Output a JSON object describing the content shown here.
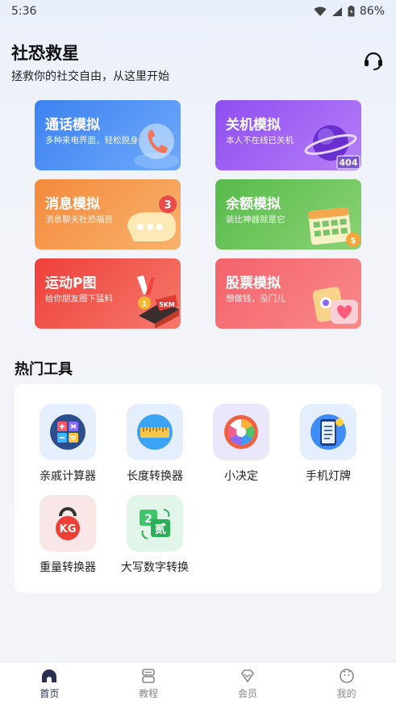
{
  "status_bar": {
    "time": "5:36",
    "battery": "86%"
  },
  "header": {
    "title": "社恐救星",
    "subtitle": "拯救你的社交自由，从这里开始"
  },
  "cards": [
    {
      "title": "通话模拟",
      "subtitle": "多种来电界面，轻松脱身",
      "icon": "phone-icon"
    },
    {
      "title": "关机模拟",
      "subtitle": "本人不在线已关机",
      "icon": "planet-icon"
    },
    {
      "title": "消息模拟",
      "subtitle": "消息聊天社恐福音",
      "icon": "message-bubble-icon"
    },
    {
      "title": "余额模拟",
      "subtitle": "装比神器就是它",
      "icon": "calendar-icon"
    },
    {
      "title": "运动P图",
      "subtitle": "给你朋友圈下猛料",
      "icon": "medal-icon"
    },
    {
      "title": "股票模拟",
      "subtitle": "想做钱，没门儿",
      "icon": "heart-card-icon"
    }
  ],
  "tools_section": {
    "title": "热门工具"
  },
  "tools": [
    {
      "label": "亲戚计算器",
      "icon": "calculator-icon"
    },
    {
      "label": "长度转换器",
      "icon": "ruler-icon"
    },
    {
      "label": "小决定",
      "icon": "spinner-wheel-icon"
    },
    {
      "label": "手机灯牌",
      "icon": "phone-lightboard-icon"
    },
    {
      "label": "重量转换器",
      "icon": "kettlebell-icon"
    },
    {
      "label": "大写数字转换",
      "icon": "number-convert-icon"
    }
  ],
  "nav": [
    {
      "label": "首页",
      "icon": "home-icon",
      "active": true
    },
    {
      "label": "教程",
      "icon": "tutorial-icon"
    },
    {
      "label": "会员",
      "icon": "vip-icon"
    },
    {
      "label": "我的",
      "icon": "profile-icon"
    }
  ],
  "colors": {
    "card_blue": "#3c82f0",
    "card_purple": "#8e4ef0",
    "card_orange": "#f48a3c",
    "card_green": "#57bb4a",
    "card_red": "#ee3f3a",
    "card_pink": "#f3626a"
  }
}
